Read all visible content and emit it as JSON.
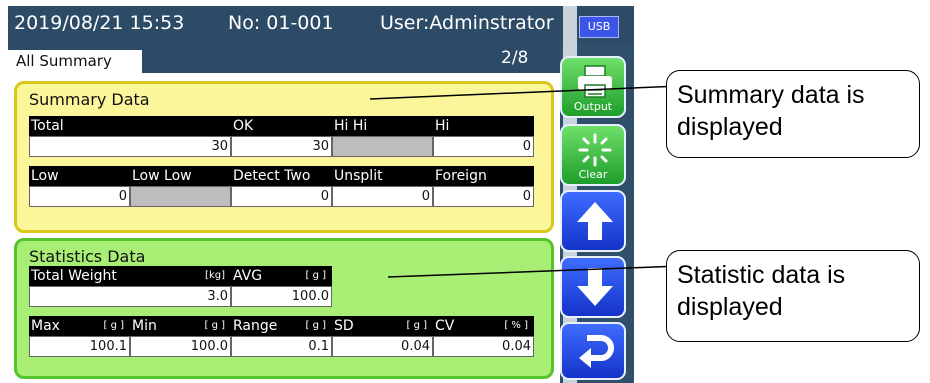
{
  "status_bar": {
    "datetime": "2019/08/21 15:53",
    "number": "No: 01-001",
    "user": "User:Adminstrator",
    "usb_label": "USB"
  },
  "screen": {
    "tab_label": "All Summary",
    "page": "2/8"
  },
  "summary": {
    "title": "Summary Data",
    "row1": {
      "headers": [
        "Total",
        "OK",
        "Hi Hi",
        "Hi"
      ],
      "values": [
        "30",
        "30",
        "",
        "0"
      ]
    },
    "row2": {
      "headers": [
        "Low",
        "Low Low",
        "Detect Two",
        "Unsplit",
        "Foreign"
      ],
      "values": [
        "0",
        "",
        "0",
        "0",
        "0"
      ]
    }
  },
  "statistics": {
    "title": "Statistics Data",
    "row1": {
      "headers": [
        {
          "label": "Total Weight",
          "unit": "[kg]"
        },
        {
          "label": "AVG",
          "unit": "[ g ]"
        }
      ],
      "values": [
        "3.0",
        "100.0"
      ]
    },
    "row2": {
      "headers": [
        {
          "label": "Max",
          "unit": "[ g ]"
        },
        {
          "label": "Min",
          "unit": "[ g ]"
        },
        {
          "label": "Range",
          "unit": "[ g ]"
        },
        {
          "label": "SD",
          "unit": "[ g ]"
        },
        {
          "label": "CV",
          "unit": "[ % ]"
        }
      ],
      "values": [
        "100.1",
        "100.0",
        "0.1",
        "0.04",
        "0.04"
      ]
    }
  },
  "side_buttons": {
    "output_label": "Output",
    "clear_label": "Clear",
    "icons": [
      "printer-icon",
      "sparkle-icon",
      "arrow-up-icon",
      "arrow-down-icon",
      "return-icon"
    ]
  },
  "callouts": {
    "summary_line1": "Summary data is",
    "summary_line2": "displayed",
    "statistics_line1": "Statistic data is",
    "statistics_line2": "displayed"
  },
  "colors": {
    "status_bar": "#2d4b66",
    "summary_panel": "#fcf69b",
    "summary_border": "#d9c81a",
    "statistics_panel": "#a9ee74",
    "statistics_border": "#55c42a",
    "usb_badge": "#3b56e6",
    "button_green": "#1e9d2a",
    "button_blue": "#1433c9"
  }
}
